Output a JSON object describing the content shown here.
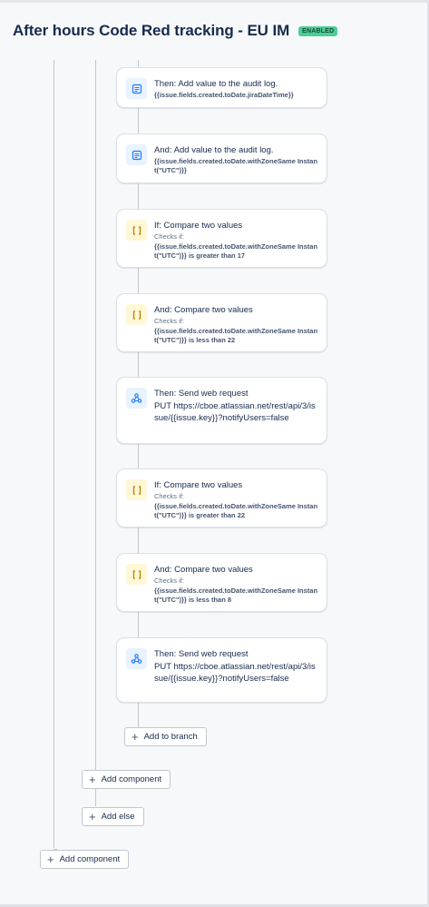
{
  "header": {
    "title": "After hours Code Red tracking - EU IM",
    "status_badge": "ENABLED"
  },
  "cards": [
    {
      "icon": "audit-log-icon",
      "title": "Then: Add value to the audit log.",
      "sub": "",
      "detail": "{{issue.fields.created.toDate.jiraDateTime}}"
    },
    {
      "icon": "audit-log-icon",
      "title": "And: Add value to the audit log.",
      "sub": "",
      "detail": "{{issue.fields.created.toDate.withZoneSame Instant(\"UTC\")}}"
    },
    {
      "icon": "compare-icon",
      "title": "If: Compare two values",
      "sub": "Checks if:",
      "detail": "{{issue.fields.created.toDate.withZoneSame Instant(\"UTC\")}} is greater than 17"
    },
    {
      "icon": "compare-icon",
      "title": "And: Compare two values",
      "sub": "Checks if:",
      "detail": "{{issue.fields.created.toDate.withZoneSame Instant(\"UTC\")}} is less than 22"
    },
    {
      "icon": "webhook-icon",
      "title": "Then: Send web request",
      "sub": "",
      "detail": "PUT https://cboe.atlassian.net/rest/api/3/issue/{{issue.key}}?notifyUsers=false"
    },
    {
      "icon": "compare-icon",
      "title": "If: Compare two values",
      "sub": "Checks if:",
      "detail": "{{issue.fields.created.toDate.withZoneSame Instant(\"UTC\")}} is greater than 22"
    },
    {
      "icon": "compare-icon",
      "title": "And: Compare two values",
      "sub": "Checks if:",
      "detail": "{{issue.fields.created.toDate.withZoneSame Instant(\"UTC\")}} is less than 8"
    },
    {
      "icon": "webhook-icon",
      "title": "Then: Send web request",
      "sub": "",
      "detail": "PUT https://cboe.atlassian.net/rest/api/3/issue/{{issue.key}}?notifyUsers=false"
    }
  ],
  "buttons": {
    "add_to_branch": "Add to branch",
    "add_component_inner": "Add component",
    "add_else": "Add else",
    "add_component_outer": "Add component"
  },
  "colors": {
    "accent_blue": "#1d7afc",
    "condition_yellow": "#b38600",
    "enabled_badge": "#4bce97"
  }
}
